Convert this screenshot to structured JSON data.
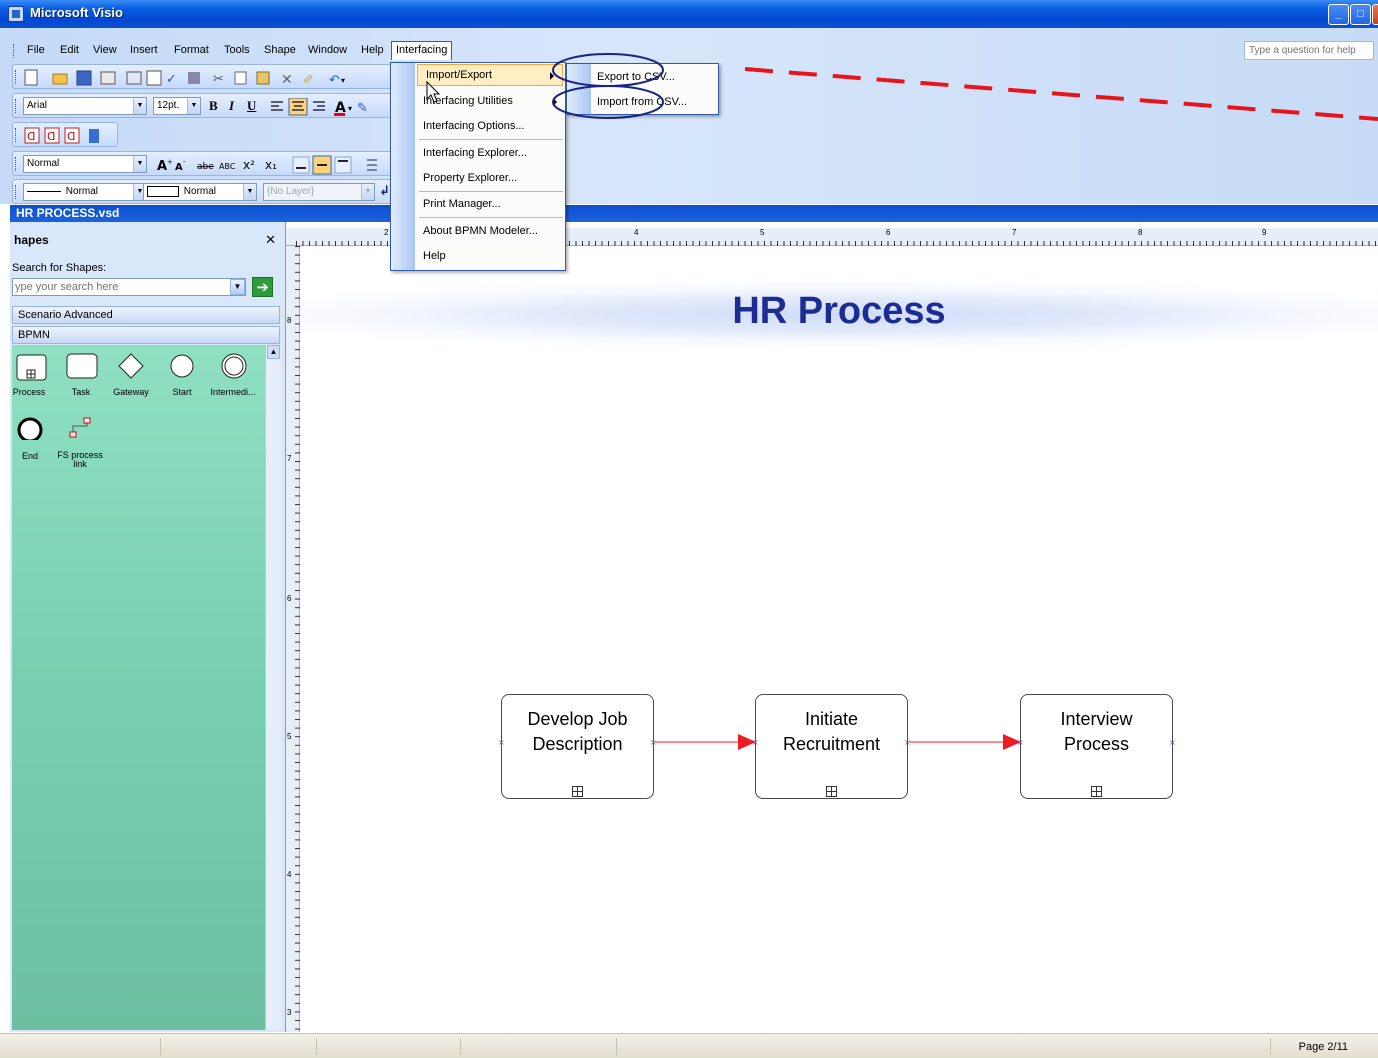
{
  "window": {
    "title": "Microsoft Visio"
  },
  "menubar": {
    "items": [
      "File",
      "Edit",
      "View",
      "Insert",
      "Format",
      "Tools",
      "Shape",
      "Window",
      "Help",
      "Interfacing"
    ],
    "help_placeholder": "Type a question for help"
  },
  "toolbar": {
    "font": "Arial",
    "size": "12pt.",
    "style": "Normal",
    "line_style": "Normal",
    "fill_style": "Normal",
    "layer": "{No Layer}"
  },
  "interfacing_menu": {
    "items": [
      {
        "label": "Import/Export",
        "submenu": true
      },
      {
        "label": "Interfacing Utilities",
        "submenu": true
      },
      {
        "label": "Interfacing Options..."
      },
      {
        "label": "Interfacing Explorer..."
      },
      {
        "label": "Property Explorer..."
      },
      {
        "label": "Print Manager..."
      },
      {
        "label": "About BPMN Modeler..."
      },
      {
        "label": "Help"
      }
    ],
    "submenu": [
      "Export to CSV...",
      "Import from CSV..."
    ]
  },
  "document": {
    "title": "HR PROCESS.vsd"
  },
  "shapes_panel": {
    "title": "hapes",
    "search_label": "Search for Shapes:",
    "search_placeholder": "ype your search here",
    "stencils": [
      "Scenario Advanced",
      "BPMN"
    ],
    "shapes": [
      "Process",
      "Task",
      "Gateway",
      "Start",
      "Intermedi...",
      "End",
      "FS process link"
    ]
  },
  "ruler": {
    "top": [
      "2",
      "4",
      "5",
      "6",
      "7",
      "8",
      "9"
    ],
    "left": [
      "8",
      "7",
      "6",
      "5",
      "4",
      "3"
    ]
  },
  "diagram": {
    "banner_title": "HR Process",
    "processes": [
      {
        "line1": "Develop Job",
        "line2": "Description"
      },
      {
        "line1": "Initiate",
        "line2": "Recruitment"
      },
      {
        "line1": "Interview",
        "line2": "Process"
      }
    ]
  },
  "statusbar": {
    "page": "Page 2/11"
  },
  "colors": {
    "title_bar": "#0a5fe0",
    "banner_text": "#1d2c93",
    "stencil_bg": "#78cfb0",
    "connector": "#ee1c24",
    "annotation_circle": "#1a237e",
    "annotation_dash": "#e8141c",
    "menu_highlight": "#ffeec2"
  }
}
